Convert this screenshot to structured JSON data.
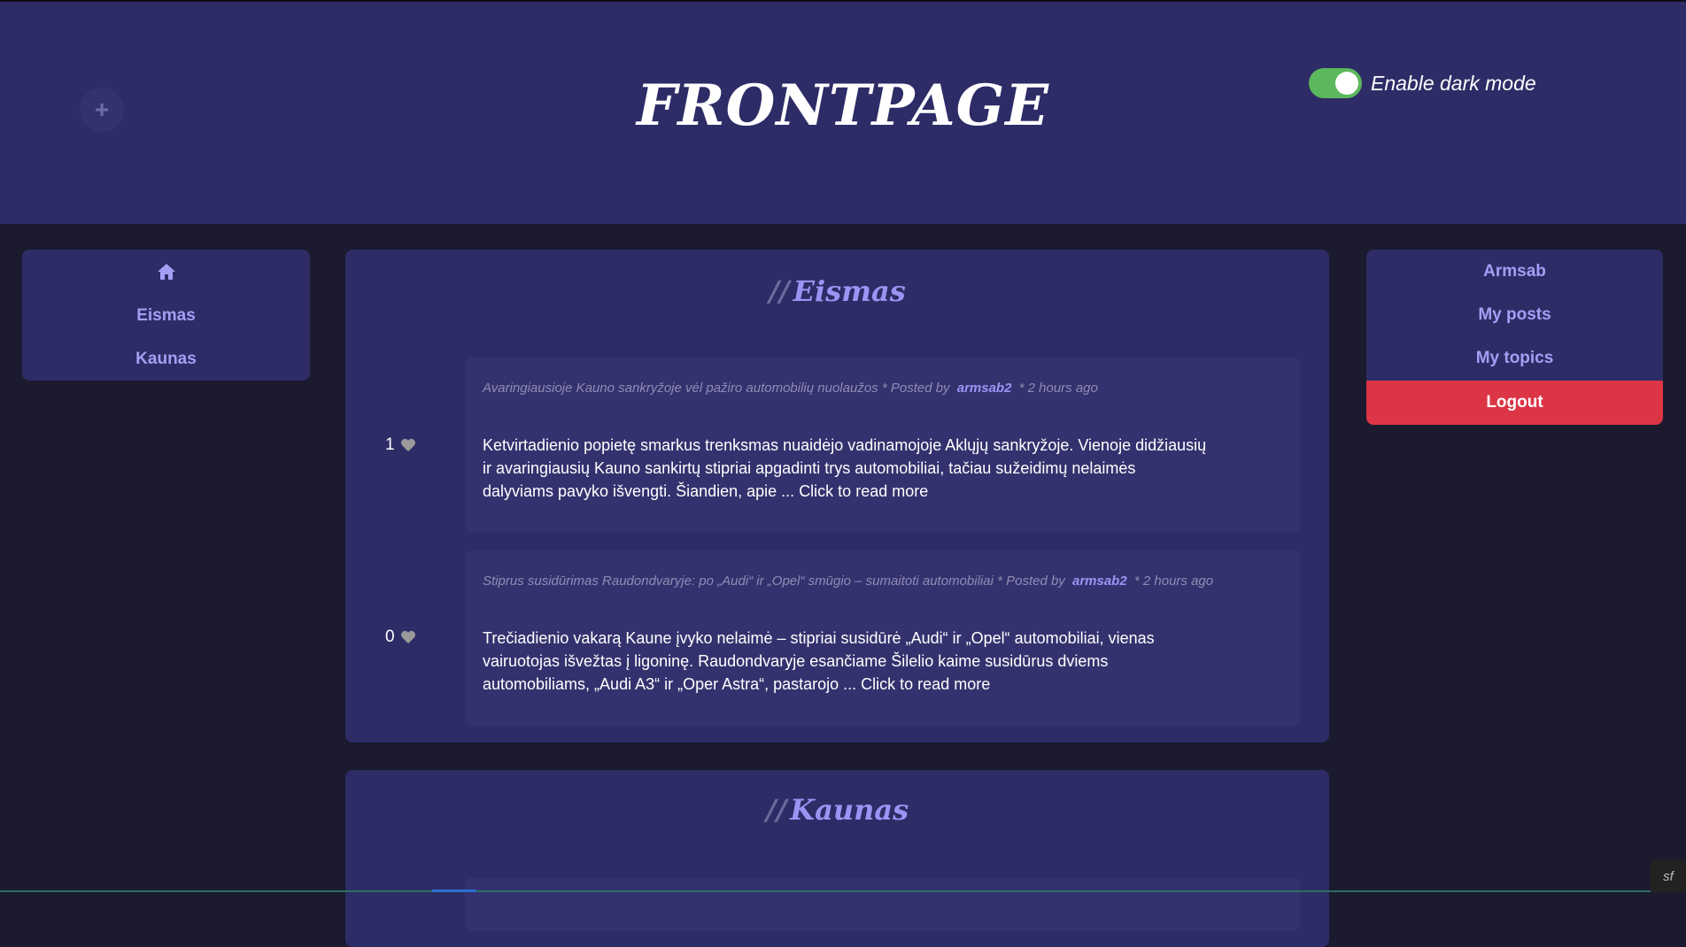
{
  "header": {
    "title": "FRONTPAGE",
    "add_symbol": "+",
    "dark_mode_label": "Enable dark mode",
    "dark_mode_enabled": true
  },
  "left_nav": {
    "home_icon": "home-icon",
    "items": [
      {
        "label": "Eismas"
      },
      {
        "label": "Kaunas"
      }
    ]
  },
  "right_nav": {
    "items": [
      {
        "label": "Armsab"
      },
      {
        "label": "My posts"
      },
      {
        "label": "My topics"
      }
    ],
    "logout_label": "Logout"
  },
  "topics": [
    {
      "slashes": "//",
      "title": "Eismas",
      "posts": [
        {
          "title": "Avaringiausioje Kauno sankryžoje vėl pažiro automobilių nuolaužos",
          "posted_by_prefix": "* Posted by",
          "author": "armsab2",
          "time": "* 2 hours ago",
          "likes": "1",
          "body": "Ketvirtadienio popietę smarkus trenksmas nuaidėjo vadinamojoje Aklųjų sankryžoje. Vienoje didžiausių ir avaringiausių Kauno sankirtų stipriai apgadinti trys automobiliai, tačiau sužeidimų nelaimės dalyviams pavyko išvengti. Šiandien, apie ... Click to read more"
        },
        {
          "title": "Stiprus susidūrimas Raudondvaryje: po „Audi“ ir „Opel“ smūgio – sumaitoti automobiliai",
          "posted_by_prefix": "* Posted by",
          "author": "armsab2",
          "time": "* 2 hours ago",
          "likes": "0",
          "body": "Trečiadienio vakarą Kaune įvyko nelaimė – stipriai susidūrė „Audi“ ir „Opel“ automobiliai, vienas vairuotojas išvežtas į ligoninę. Raudondvaryje esančiame Šilelio kaime susidūrus dviems automobiliams, „Audi A3“ ir „Oper Astra“, pastarojo ... Click to read more"
        }
      ]
    },
    {
      "slashes": "//",
      "title": "Kaunas",
      "posts": []
    }
  ],
  "debug_badge": "sf",
  "colors": {
    "header_bg": "#2e2c66",
    "page_bg": "#1b1a2e",
    "accent": "#9b94f5",
    "logout": "#dc3545",
    "toggle_on": "#5cb85c"
  }
}
